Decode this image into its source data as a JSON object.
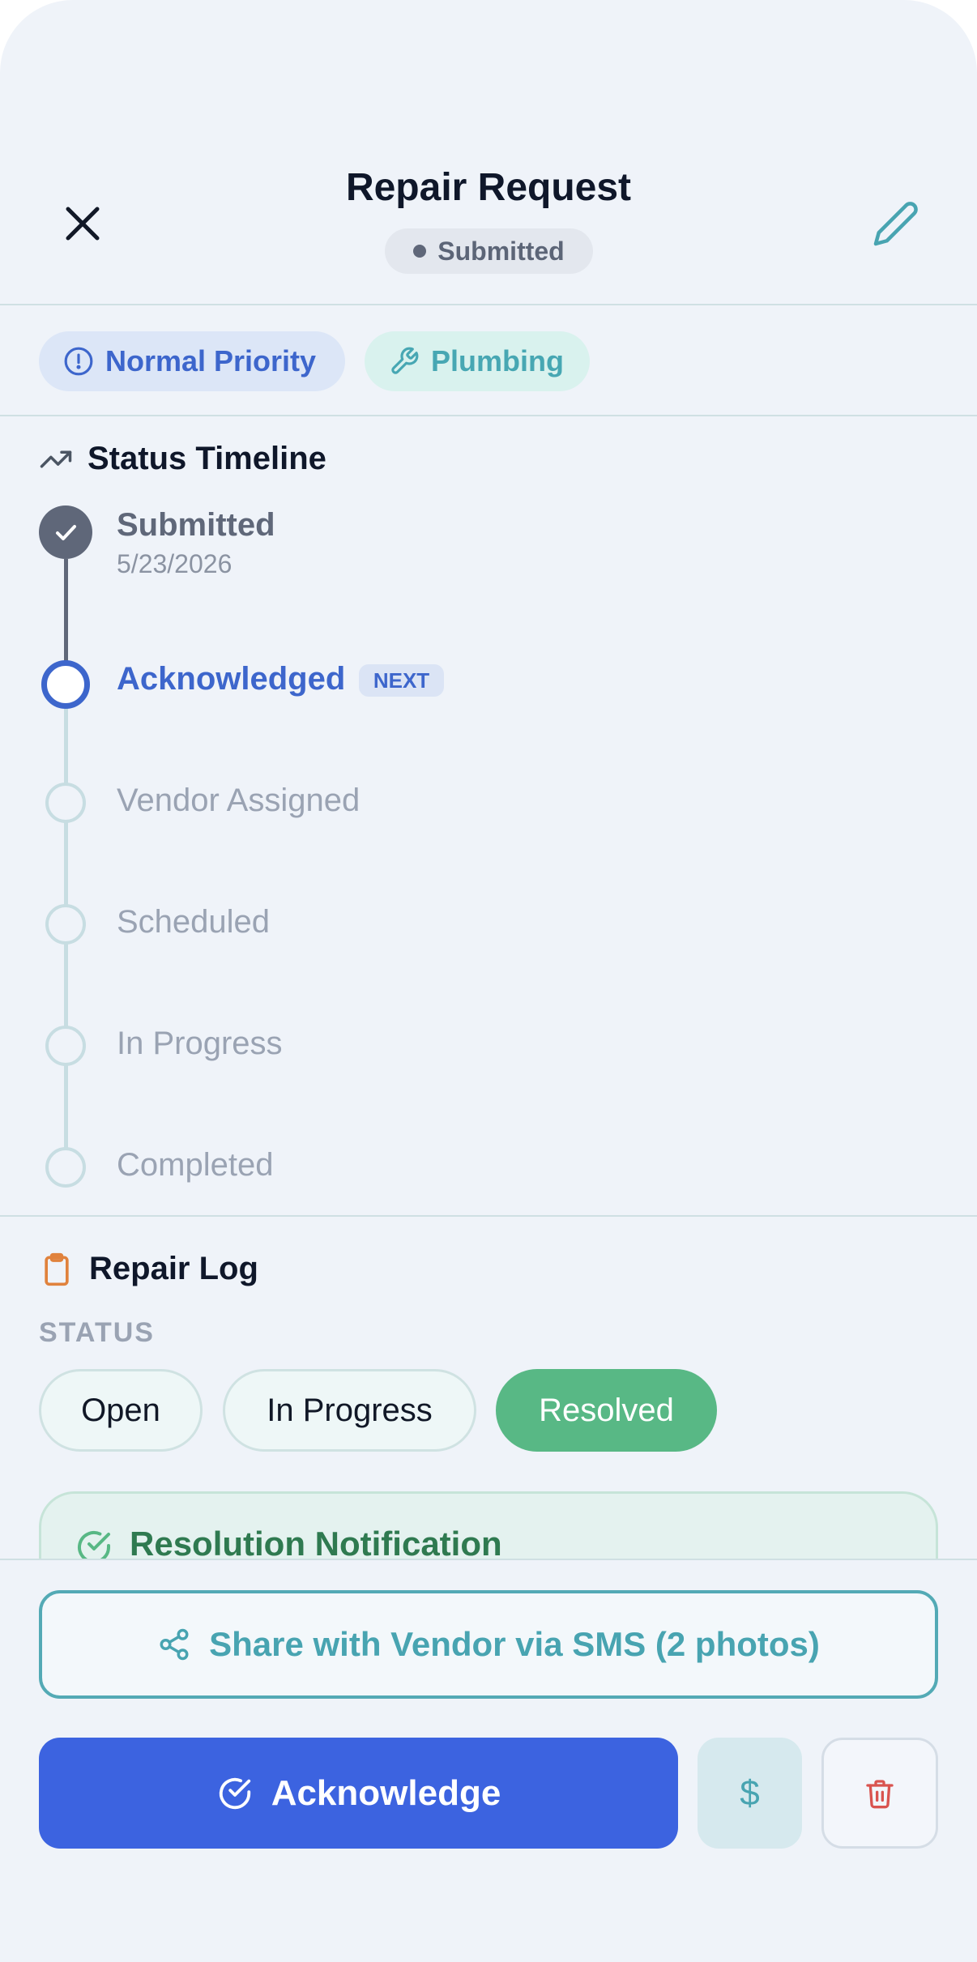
{
  "header": {
    "title": "Repair Request",
    "status": "Submitted",
    "close_icon": "close-icon",
    "edit_icon": "pencil-icon"
  },
  "tags": {
    "priority": "Normal Priority",
    "category": "Plumbing"
  },
  "timeline": {
    "title": "Status Timeline",
    "next_badge": "NEXT",
    "steps": [
      {
        "label": "Submitted",
        "date": "5/23/2026",
        "state": "done"
      },
      {
        "label": "Acknowledged",
        "state": "next"
      },
      {
        "label": "Vendor Assigned",
        "state": "pending"
      },
      {
        "label": "Scheduled",
        "state": "pending"
      },
      {
        "label": "In Progress",
        "state": "pending"
      },
      {
        "label": "Completed",
        "state": "pending"
      }
    ]
  },
  "repair_log": {
    "title": "Repair Log",
    "status_heading": "STATUS",
    "options": [
      "Open",
      "In Progress",
      "Resolved"
    ],
    "selected": "Resolved",
    "notification_title": "Resolution Notification"
  },
  "actions": {
    "share": "Share with Vendor via SMS (2 photos)",
    "primary": "Acknowledge",
    "cost_symbol": "$"
  },
  "colors": {
    "primary": "#3c63e0",
    "teal": "#48a4b1",
    "success": "#58b885",
    "danger": "#d9534f"
  }
}
